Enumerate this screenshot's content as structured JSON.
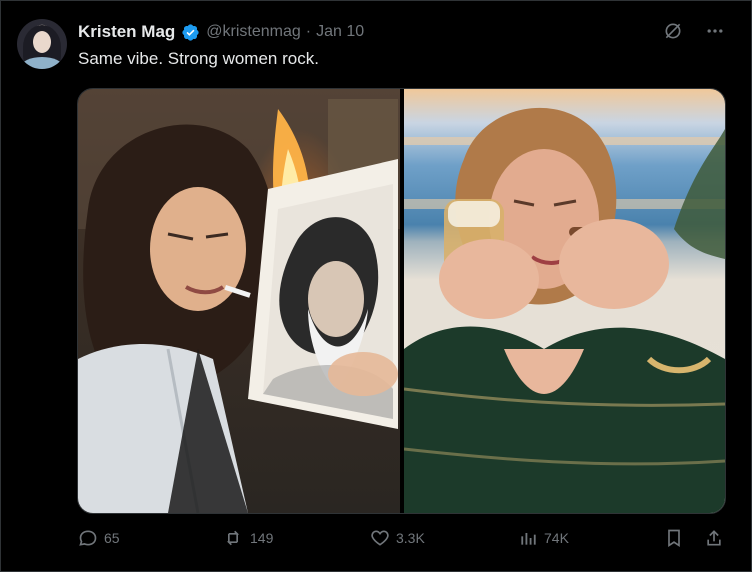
{
  "author": {
    "name": "Kristen Mag",
    "handle": "@kristenmag",
    "separator": "·",
    "date": "Jan 10",
    "verified_icon": "verified-badge-icon",
    "verified_color": "#1d9bf0"
  },
  "tweet": {
    "text": "Same vibe. Strong women rock."
  },
  "top_actions": {
    "grok_icon": "grok-icon",
    "more_icon": "more-dots-icon"
  },
  "media": {
    "count": 2,
    "items": [
      {
        "icon": "photo-left"
      },
      {
        "icon": "photo-right"
      }
    ]
  },
  "engagement": {
    "replies": "65",
    "reposts": "149",
    "likes": "3.3K",
    "views": "74K",
    "reply_icon": "reply-icon",
    "repost_icon": "repost-icon",
    "like_icon": "like-icon",
    "views_icon": "views-icon",
    "bookmark_icon": "bookmark-icon",
    "share_icon": "share-icon"
  },
  "colors": {
    "background": "#000000",
    "text": "#e7e9ea",
    "muted": "#71767b",
    "accent": "#1d9bf0"
  }
}
